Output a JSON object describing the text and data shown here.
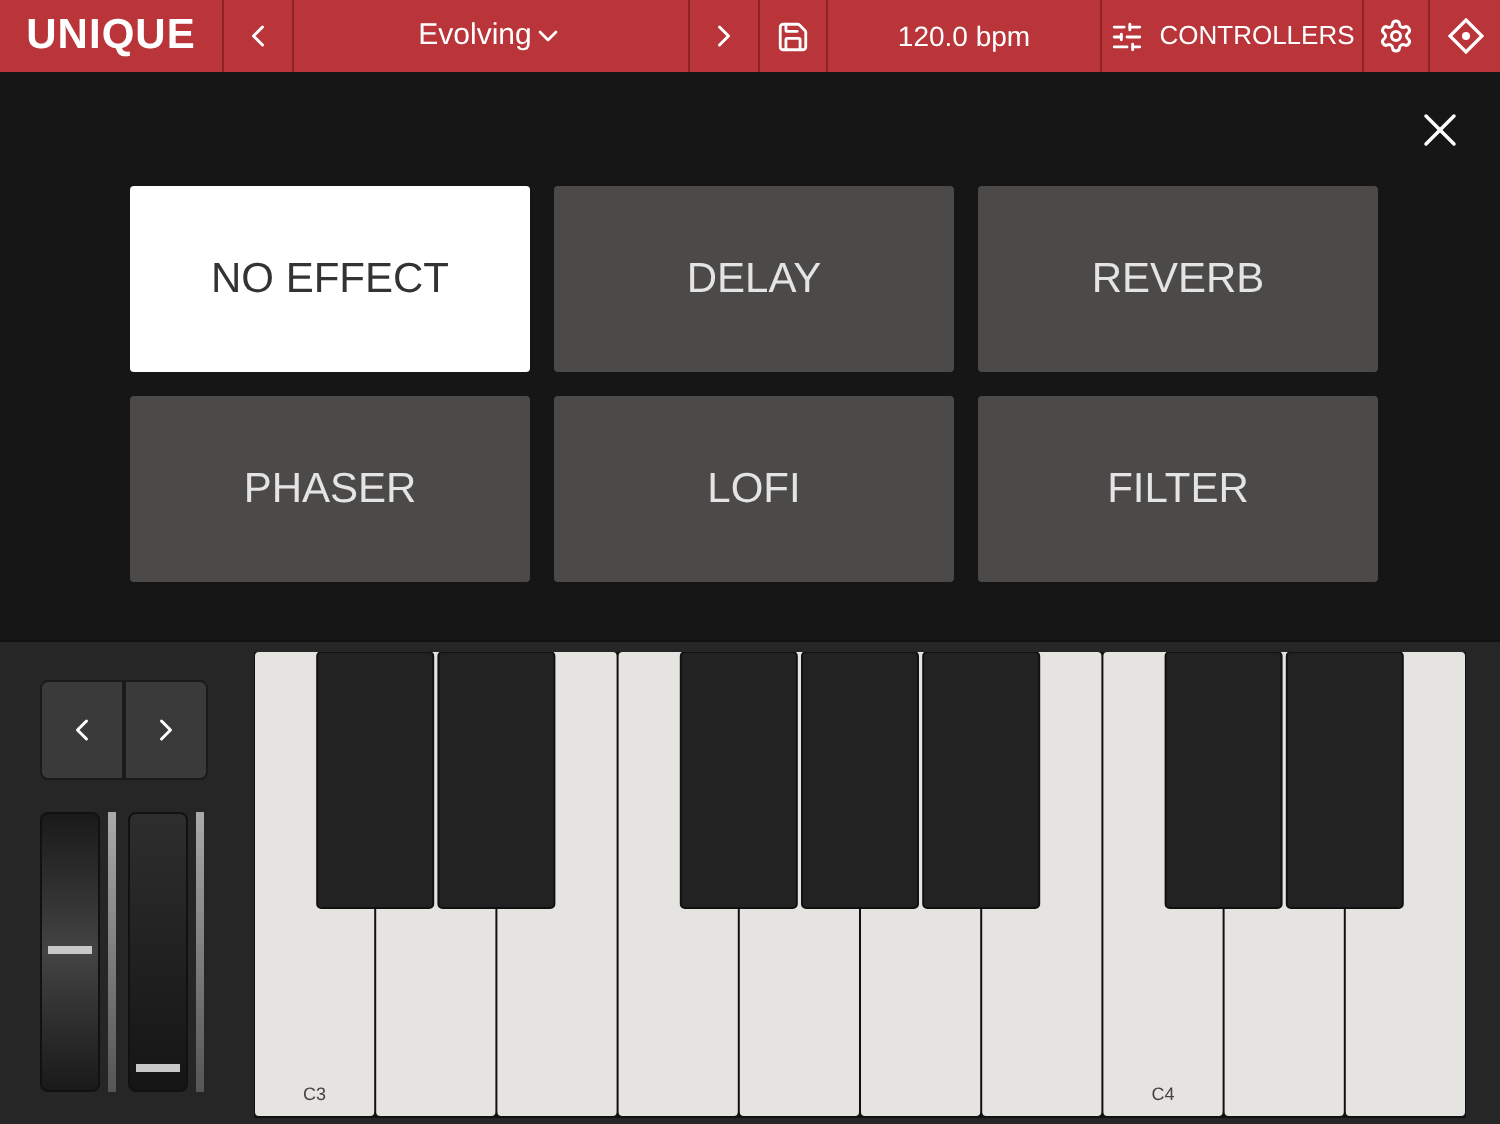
{
  "toolbar": {
    "logo": "UNIQUE",
    "preset": "Evolving",
    "tempo": "120.0 bpm",
    "controllers": "CONTROLLERS"
  },
  "effects": [
    {
      "label": "NO EFFECT",
      "selected": true
    },
    {
      "label": "DELAY",
      "selected": false
    },
    {
      "label": "REVERB",
      "selected": false
    },
    {
      "label": "PHASER",
      "selected": false
    },
    {
      "label": "LOFI",
      "selected": false
    },
    {
      "label": "FILTER",
      "selected": false
    }
  ],
  "wheels": [
    {
      "kind": "pitch",
      "level": 0.5
    },
    {
      "kind": "mod",
      "level": 0.05
    }
  ],
  "keyboard": {
    "key_labels": [
      "C3",
      "C4"
    ]
  }
}
